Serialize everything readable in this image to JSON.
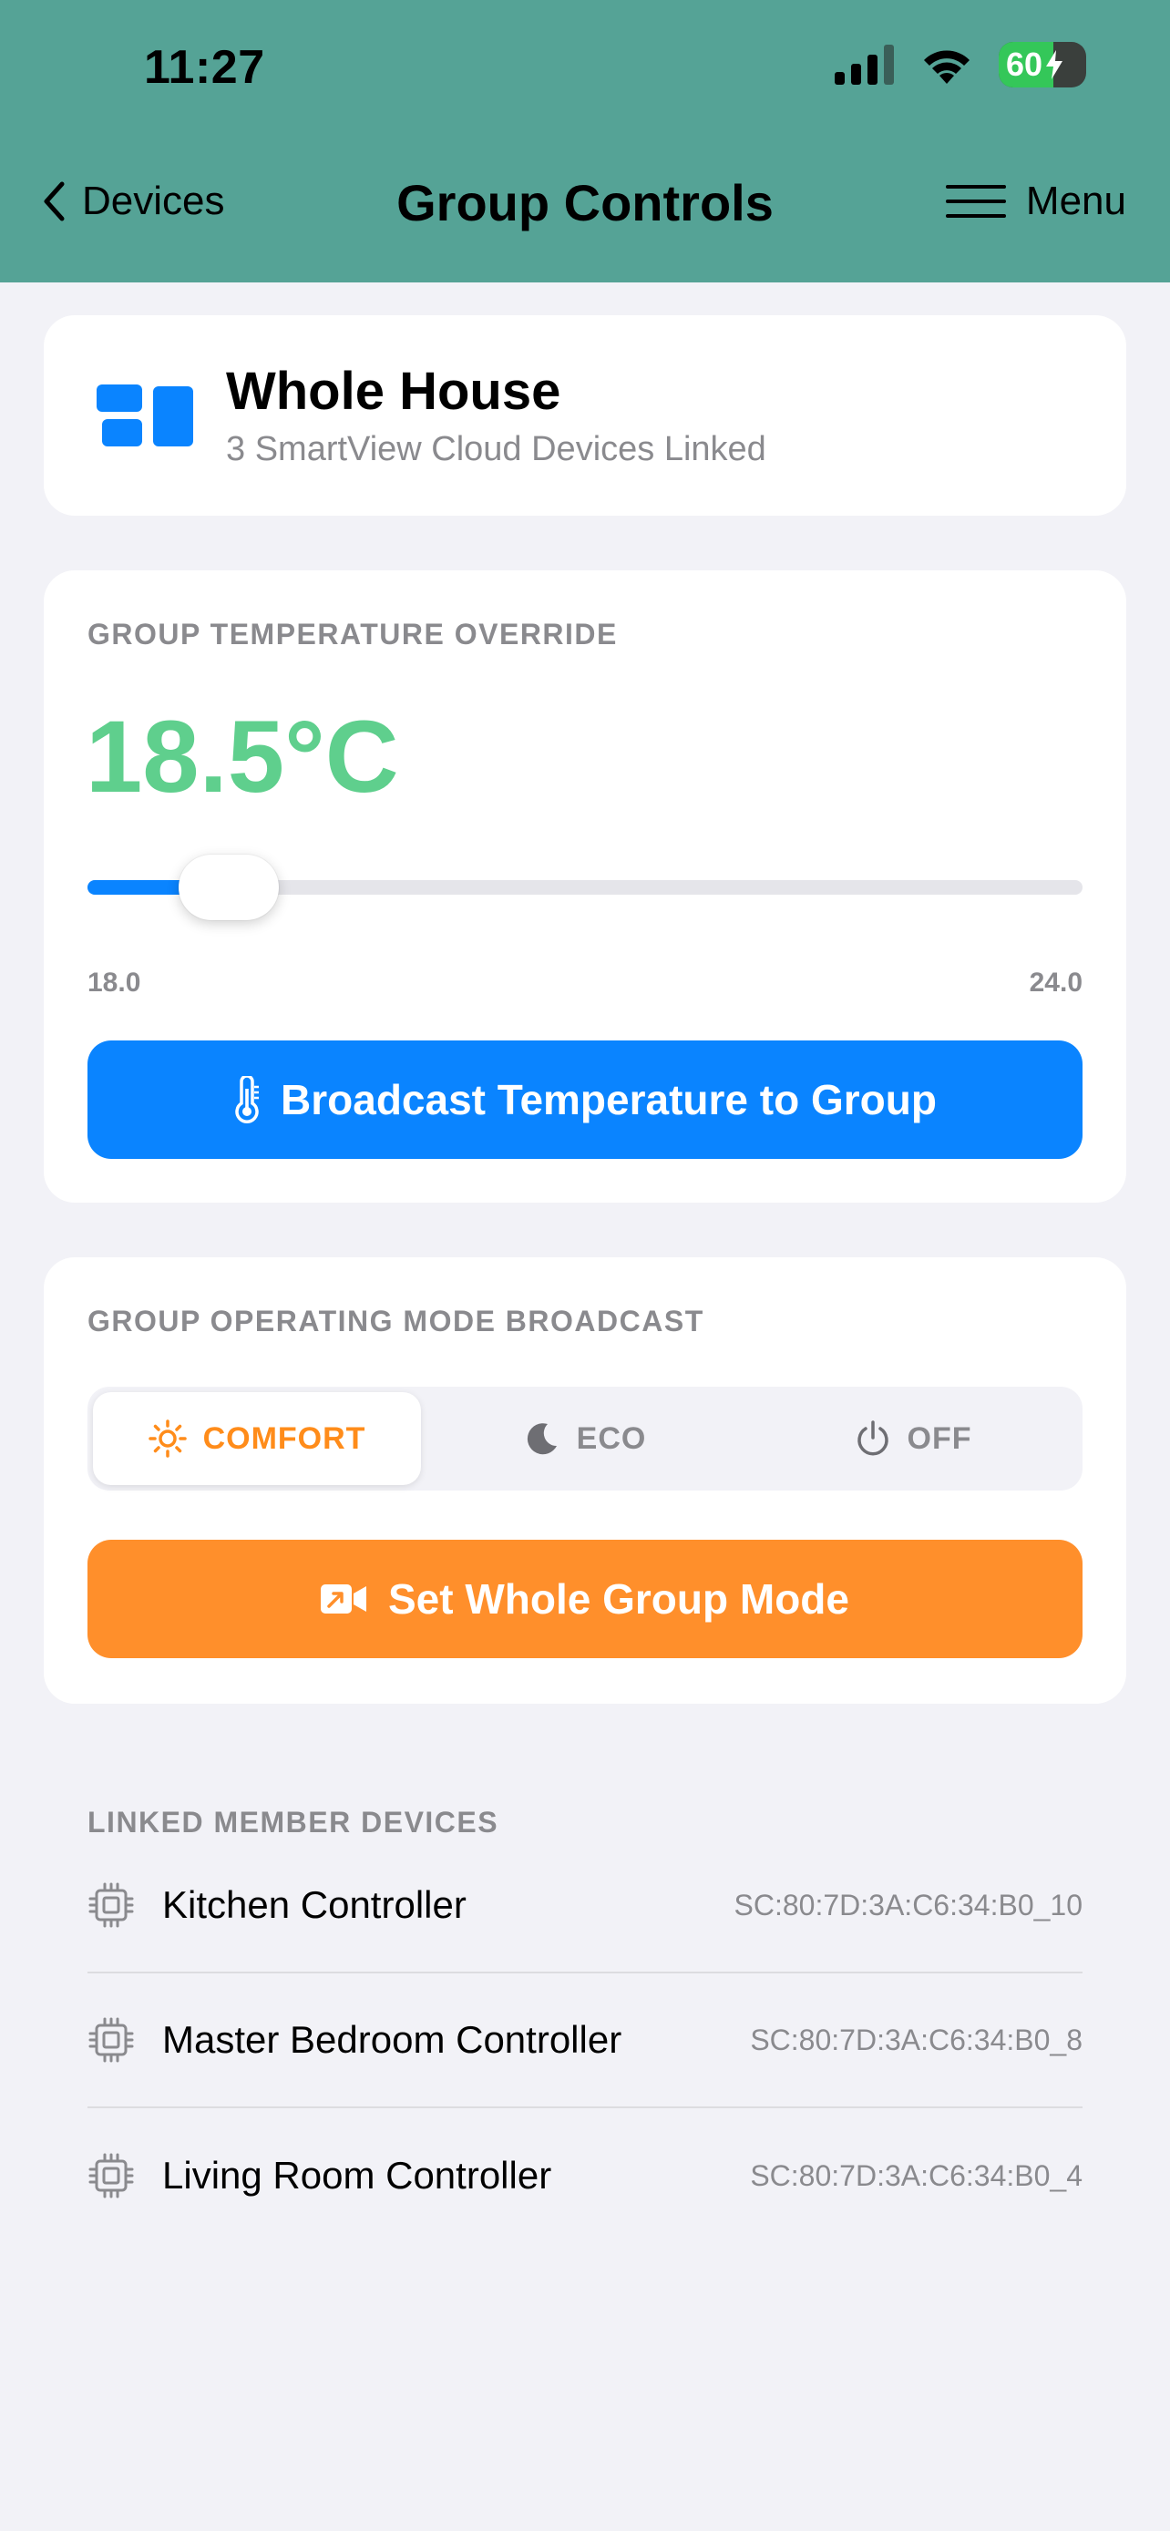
{
  "status_bar": {
    "time": "11:27",
    "battery": "60"
  },
  "nav": {
    "back_label": "Devices",
    "title": "Group Controls",
    "menu_label": "Menu"
  },
  "group": {
    "name": "Whole House",
    "subtitle": "3 SmartView Cloud Devices Linked"
  },
  "temperature": {
    "section_label": "GROUP TEMPERATURE OVERRIDE",
    "value_display": "18.5°C",
    "value": 18.5,
    "min": 18.0,
    "max": 24.0,
    "min_label": "18.0",
    "max_label": "24.0",
    "button_label": "Broadcast Temperature to Group"
  },
  "mode": {
    "section_label": "GROUP OPERATING MODE BROADCAST",
    "options": [
      {
        "label": "COMFORT",
        "icon": "sun-icon",
        "selected": true
      },
      {
        "label": "ECO",
        "icon": "moon-icon",
        "selected": false
      },
      {
        "label": "OFF",
        "icon": "power-icon",
        "selected": false
      }
    ],
    "button_label": "Set Whole Group Mode"
  },
  "linked": {
    "section_label": "LINKED MEMBER DEVICES",
    "devices": [
      {
        "name": "Kitchen Controller",
        "id": "SC:80:7D:3A:C6:34:B0_10"
      },
      {
        "name": "Master Bedroom Controller",
        "id": "SC:80:7D:3A:C6:34:B0_8"
      },
      {
        "name": "Living Room Controller",
        "id": "SC:80:7D:3A:C6:34:B0_4"
      }
    ]
  },
  "colors": {
    "header": "#55a396",
    "accent_blue": "#0a84ff",
    "accent_orange": "#ff8f2b",
    "temp_green": "#5fcf8d",
    "secondary_text": "#8a8a8e"
  }
}
